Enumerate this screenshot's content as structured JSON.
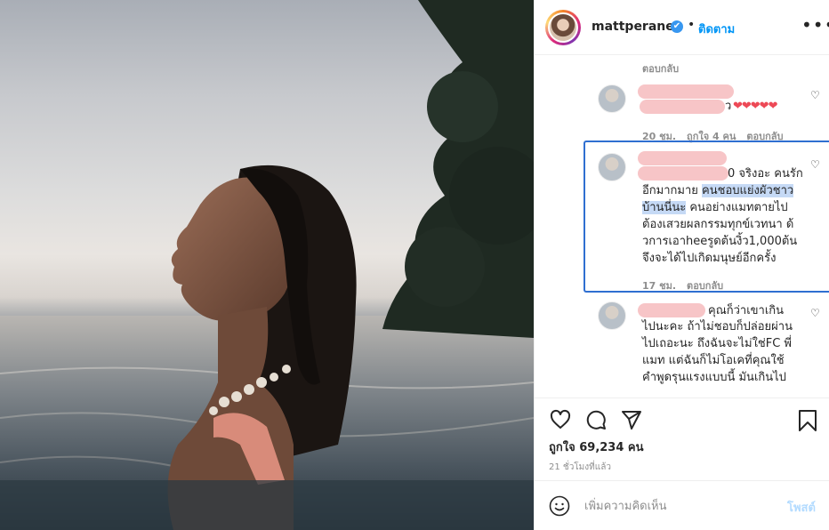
{
  "post": {
    "username": "mattperanee",
    "verified_mark": "✔",
    "separator": "•",
    "follow_label": "ติดตาม",
    "more_label": "•••"
  },
  "comments": {
    "reply_top": "ตอบกลับ",
    "c1": {
      "text_tail": "ว",
      "hearts": "❤❤❤❤❤",
      "time": "20 ชม.",
      "likes": "ถูกใจ 4 คน",
      "reply": "ตอบกลับ"
    },
    "c2": {
      "line1_tail": "0 จริงอะ คนรัก",
      "line2_a": "อีกมากมาย ",
      "line2_hl": "คนชอบแย่งผัวชาว",
      "line3_hl": "บ้านนี่นะ",
      "line3_b": " คนอย่างแมทตายไป",
      "line4": "ต้องเสวยผลกรรมทุกข์เวทนา ด้",
      "line5": "วการเอาheeรูดต้นงิ้ว1,000ต้น",
      "line6": "จึงจะได้ไปเกิดมนุษย์อีกครั้ง",
      "time": "17 ชม.",
      "reply": "ตอบกลับ"
    },
    "c3": {
      "line1_tail": "คุณก็ว่าเขาเกิน",
      "line2": "ไปนะคะ ถ้าไม่ชอบก็ปล่อยผ่าน",
      "line3": "ไปเถอะนะ ถึงฉันจะไม่ใช่FC พี่",
      "line4": "แมท แต่ฉันก็ไม่โอเคที่คุณใช้",
      "line5": "คำพูดรุนแรงแบบนี้ มันเกินไป"
    }
  },
  "actions": {
    "icons": [
      "heart-icon",
      "comment-icon",
      "share-icon",
      "bookmark-icon"
    ],
    "likes_text": "ถูกใจ 69,234 คน",
    "time_ago": "21 ชั่วโมงที่แล้ว"
  },
  "add_comment": {
    "placeholder": "เพิ่มความคิดเห็น",
    "post_label": "โพสต์"
  },
  "colors": {
    "link_blue": "#0095f6",
    "highlight_border": "#2f6fd1",
    "heart_red": "#ed4956"
  }
}
